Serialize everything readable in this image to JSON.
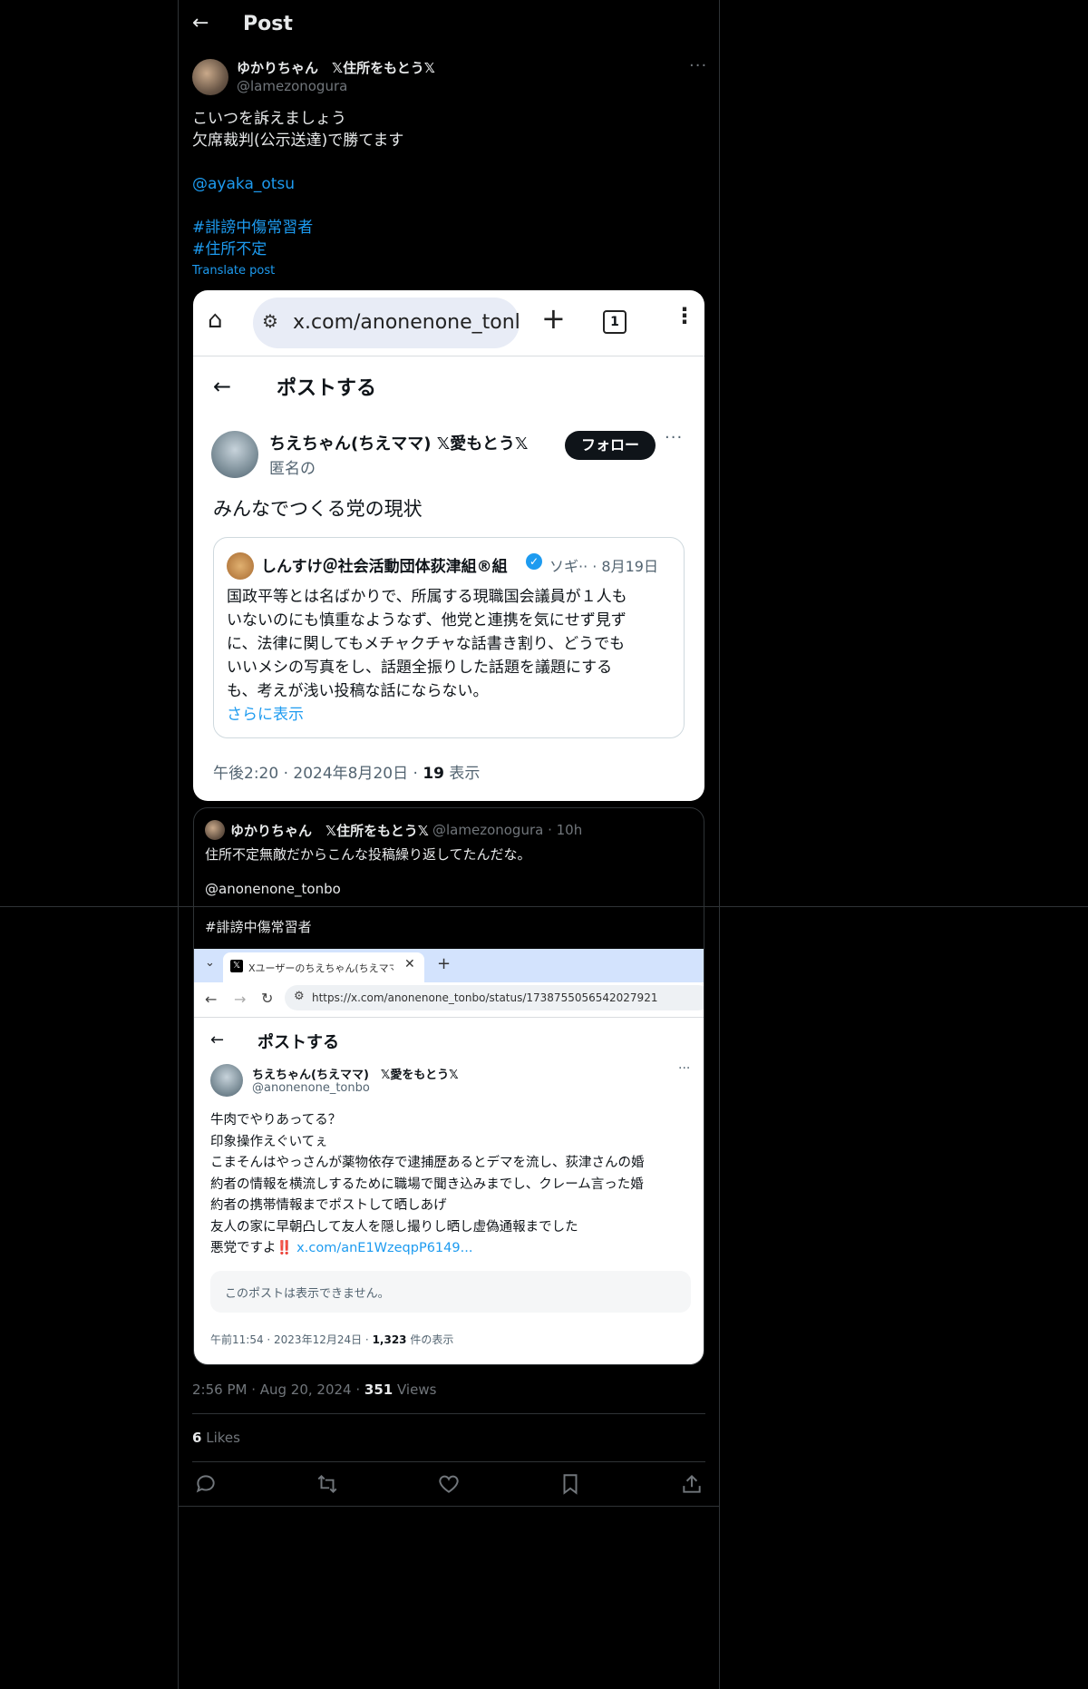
{
  "header": {
    "title": "Post"
  },
  "author": {
    "name": "ゆかりちゃん　𝕏住所をもとう𝕏",
    "handle": "@lamezonogura"
  },
  "post": {
    "line1": "こいつを訴えましょう",
    "line2": "欠席裁判(公示送達)で勝てます",
    "mention": "@ayaka_otsu",
    "hashtag1": "#誹謗中傷常習者",
    "hashtag2": "#住所不定",
    "translate": "Translate post"
  },
  "shot1": {
    "url": "x.com/anonenone_tonl",
    "tab_count": "1",
    "page_title": "ポストする",
    "author_name": "ちえちゃん(ちえママ) 𝕏愛もとう𝕏",
    "author_sub": "匿名の",
    "follow": "フォロー",
    "text": "みんなでつくる党の現状",
    "quote": {
      "name": "しんすけ＠社会活動団体荻津組®組",
      "meta": "ソギ·· · 8月19日",
      "lines": [
        "国政平等とは名ばかりで、所属する現職国会議員が１人も",
        "いないのにも慎重なようなず、他党と連携を気にせず見ず",
        "に、法律に関してもメチャクチャな話書き割り、どうでも",
        "いいメシの写真をし、話題全振りした話題を議題にする",
        "も、考えが浅い投稿な話にならない。"
      ],
      "more": "さらに表示"
    },
    "timestamp": "午後2:20 · 2024年8月20日 · ",
    "views_count": "19",
    "views_label": " 表示"
  },
  "quoted_post": {
    "name": "ゆかりちゃん　𝕏住所をもとう𝕏",
    "handle_time": "@lamezonogura · 10h",
    "line1": "住所不定無敵だからこんな投稿繰り返してたんだな。",
    "mention": "@anonenone_tonbo",
    "hashtag": "#誹謗中傷常習者"
  },
  "shot2": {
    "tab_label": "Xユーザーのちえちゃん(ちえママ)　𝕏",
    "url": "https://x.com/anonenone_tonbo/status/1738755056542027921",
    "page_title": "ポストする",
    "author_name": "ちえちゃん(ちえママ)　𝕏愛をもとう𝕏",
    "author_handle": "@anonenone_tonbo",
    "lines": [
      "牛肉でやりあってる？",
      "印象操作えぐいてぇ",
      "こまそんはやっさんが薬物依存で逮捕歴あるとデマを流し、荻津さんの婚",
      "約者の情報を横流しするために職場で聞き込みまでし、クレーム言った婚",
      "約者の携帯情報までポストして晒しあげ",
      "友人の家に早朝凸して友人を隠し撮りし晒し虚偽通報までした"
    ],
    "last_line": "悪党ですよ‼️",
    "last_link": "x.com/anE1WzeqpP6149...",
    "unavailable": "このポストは表示できません。",
    "timestamp": "午前11:54 · 2023年12月24日 · ",
    "views_count": "1,323",
    "views_label": " 件の表示"
  },
  "meta": {
    "time": "2:56 PM · Aug 20, 2024 · ",
    "views_count": "351",
    "views_label": " Views"
  },
  "likes": {
    "count": "6",
    "label": " Likes"
  },
  "colors": {
    "accent": "#1d9bf0",
    "border": "#2f3336",
    "muted": "#71767b"
  }
}
